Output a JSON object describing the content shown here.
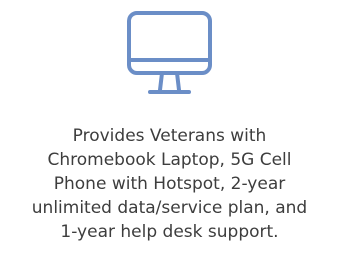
{
  "card": {
    "icon": "desktop-monitor-icon",
    "icon_color": "#6b8ec7",
    "text_color": "#3d3d3d",
    "description_lines": [
      "Provides Veterans with",
      "Chromebook Laptop, 5G Cell",
      "Phone with Hotspot, 2-year",
      "unlimited data/service plan, and",
      "1-year help desk support."
    ]
  }
}
